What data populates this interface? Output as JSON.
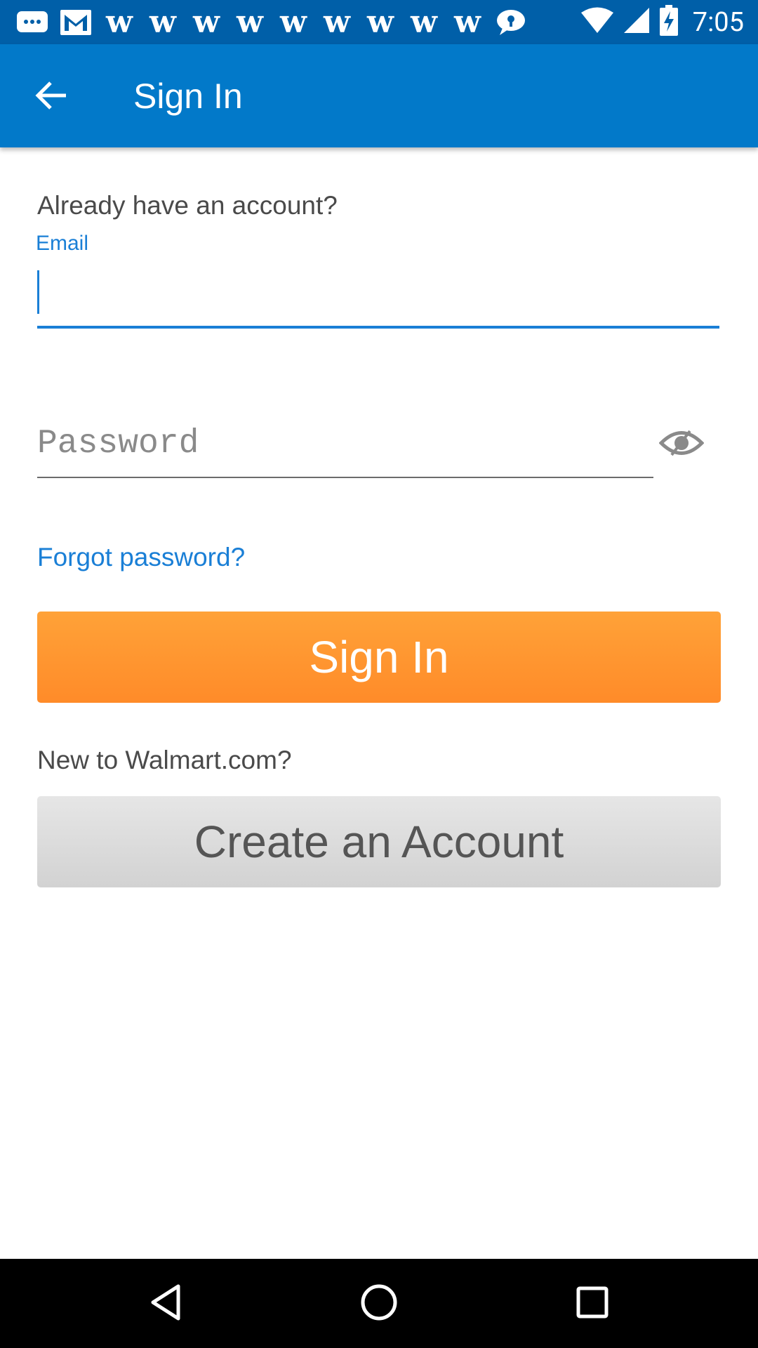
{
  "status_bar": {
    "time": "7:05",
    "notification_icons": [
      "chat-bubble-icon",
      "gmail-icon",
      "walmart-w-icon",
      "walmart-w-icon",
      "walmart-w-icon",
      "walmart-w-icon",
      "walmart-w-icon",
      "walmart-w-icon",
      "walmart-w-icon",
      "walmart-w-icon",
      "walmart-w-icon",
      "speech-bubble-icon"
    ],
    "system_icons": [
      "wifi-icon",
      "cell-signal-icon",
      "battery-charging-icon"
    ],
    "w_glyph": "w"
  },
  "app_bar": {
    "title": "Sign In",
    "color": "#0279c9"
  },
  "form": {
    "already_text": "Already have an account?",
    "email_label": "Email",
    "email_value": "",
    "password_placeholder": "Password",
    "password_value": "",
    "forgot_link": "Forgot password?",
    "signin_button": "Sign In",
    "new_text": "New to Walmart.com?",
    "create_button": "Create an Account"
  },
  "colors": {
    "accent": "#1a7fd6",
    "signin_orange": "#ff9a30",
    "status_bar": "#005fa8"
  },
  "nav_bar": {
    "icons": [
      "back-triangle-icon",
      "home-circle-icon",
      "recents-square-icon"
    ]
  }
}
